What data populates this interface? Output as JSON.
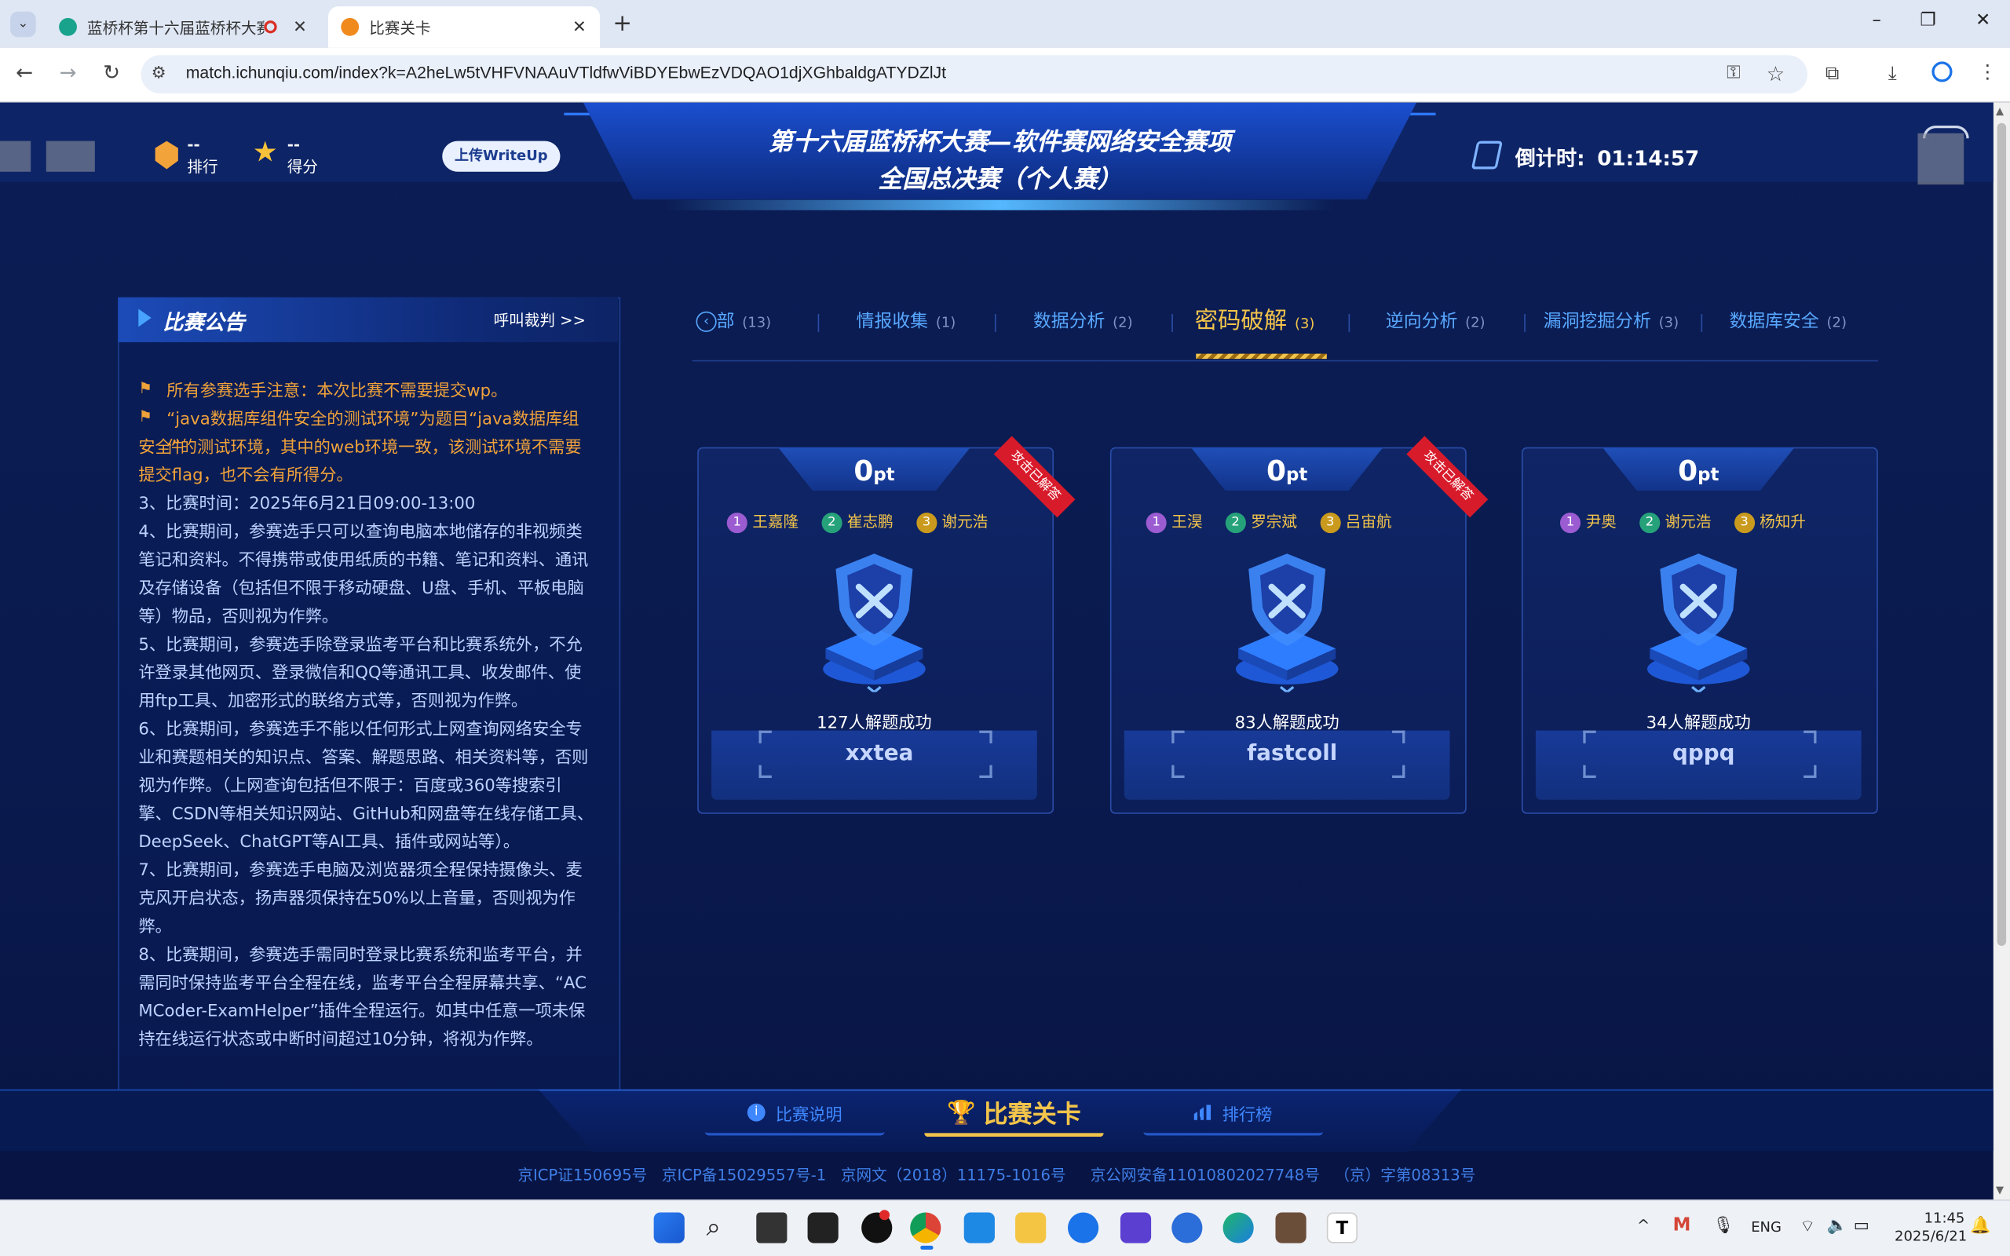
{
  "browser": {
    "tabs": [
      {
        "title": "蓝桥杯第十六届蓝桥杯大赛",
        "active": false
      },
      {
        "title": "比赛关卡",
        "active": true
      }
    ],
    "new_tab": "+",
    "url": "match.ichunqiu.com/index?k=A2heLw5tVHFVNAAuVTldfwViBDYEbwEzVDQAO1djXGhbaldgATYDZlJt",
    "window_controls": [
      "–",
      "❐",
      "✕"
    ]
  },
  "header": {
    "rank_value": "--",
    "rank_label": "排行",
    "score_value": "--",
    "score_label": "得分",
    "upload_button": "上传WriteUp",
    "title_line1": "第十六届蓝桥杯大赛—软件赛网络安全赛项",
    "title_line2": "全国总决赛（个人赛）",
    "countdown_label": "倒计时:",
    "countdown_value": "01:14:57"
  },
  "announcement": {
    "title": "比赛公告",
    "call_referee": "呼叫裁判 >>",
    "lines": [
      "所有参赛选手注意：本次比赛不需要提交wp。",
      "“java数据库组件安全的测试环境”为题目“java数据库组件",
      "安全”的测试环境，其中的web环境一致，该测试环境不需要",
      "提交flag，也不会有所得分。",
      "3、比赛时间：2025年6月21日09:00-13:00",
      "4、比赛期间，参赛选手只可以查询电脑本地储存的非视频类",
      "笔记和资料。不得携带或使用纸质的书籍、笔记和资料、通讯",
      "及存储设备（包括但不限于移动硬盘、U盘、手机、平板电脑",
      "等）物品，否则视为作弊。",
      "5、比赛期间，参赛选手除登录监考平台和比赛系统外，不允",
      "许登录其他网页、登录微信和QQ等通讯工具、收发邮件、使",
      "用ftp工具、加密形式的联络方式等，否则视为作弊。",
      "6、比赛期间，参赛选手不能以任何形式上网查询网络安全专",
      "业和赛题相关的知识点、答案、解题思路、相关资料等，否则",
      "视为作弊。（上网查询包括但不限于：百度或360等搜索引",
      "擎、CSDN等相关知识网站、GitHub和网盘等在线存储工具、",
      "DeepSeek、ChatGPT等AI工具、插件或网站等）。",
      "7、比赛期间，参赛选手电脑及浏览器须全程保持摄像头、麦",
      "克风开启状态，扬声器须保持在50%以上音量，否则视为作",
      "弊。",
      "8、比赛期间，参赛选手需同时登录比赛系统和监考平台，并",
      "需同时保持监考平台全程在线，监考平台全程屏幕共享、“AC",
      "MCoder-ExamHelper”插件全程运行。如其中任意一项未保",
      "持在线运行状态或中断时间超过10分钟，将视为作弊。"
    ]
  },
  "categories": [
    {
      "label": "部",
      "count": "(13)"
    },
    {
      "label": "情报收集",
      "count": "(1)"
    },
    {
      "label": "数据分析",
      "count": "(2)"
    },
    {
      "label": "密码破解",
      "count": "(3)",
      "active": true
    },
    {
      "label": "逆向分析",
      "count": "(2)"
    },
    {
      "label": "漏洞挖掘分析",
      "count": "(3)"
    },
    {
      "label": "数据库安全",
      "count": "(2)"
    }
  ],
  "challenges": [
    {
      "points": "0",
      "unit": "pt",
      "solvers": [
        "王嘉隆",
        "崔志鹏",
        "谢元浩"
      ],
      "solved_text": "127人解题成功",
      "name": "xxtea",
      "ribbon": "攻击已解答"
    },
    {
      "points": "0",
      "unit": "pt",
      "solvers": [
        "王淏",
        "罗宗斌",
        "吕宙航"
      ],
      "solved_text": "83人解题成功",
      "name": "fastcoll",
      "ribbon": "攻击已解答"
    },
    {
      "points": "0",
      "unit": "pt",
      "solvers": [
        "尹奥",
        "谢元浩",
        "杨知升"
      ],
      "solved_text": "34人解题成功",
      "name": "qppq",
      "ribbon": ""
    }
  ],
  "bottom_nav": {
    "rules": "比赛说明",
    "levels": "比赛关卡",
    "leaderboard": "排行榜"
  },
  "footer": {
    "text": "京ICP证150695号   京ICP备15029557号-1   京网文（2018）11175-1016号     京公网安备11010802027748号   （京）字第08313号"
  },
  "taskbar": {
    "lang": "ENG",
    "time": "11:45",
    "date": "2025/6/21"
  },
  "colors": {
    "accent_blue": "#3f87ff",
    "active_gold": "#f2c44b",
    "warning_orange": "#f0a23a",
    "ribbon_red": "#d81b2b"
  }
}
